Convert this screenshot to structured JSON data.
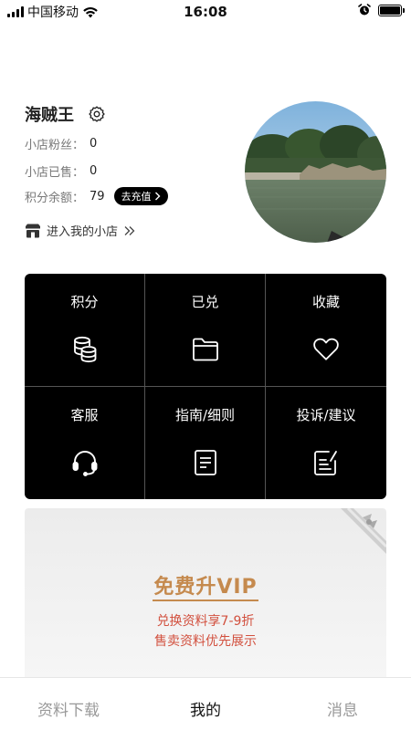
{
  "status_bar": {
    "carrier": "中国移动",
    "time": "16:08"
  },
  "profile": {
    "username": "海贼王",
    "fans_label": "小店粉丝：",
    "fans_value": "0",
    "sold_label": "小店已售：",
    "sold_value": "0",
    "points_label": "积分余额：",
    "points_value": "79",
    "recharge_label": "去充值",
    "enter_shop_label": "进入我的小店"
  },
  "menu": {
    "items": [
      {
        "label": "积分",
        "icon": "coins-icon"
      },
      {
        "label": "已兑",
        "icon": "folder-icon"
      },
      {
        "label": "收藏",
        "icon": "heart-icon"
      },
      {
        "label": "客服",
        "icon": "headset-icon"
      },
      {
        "label": "指南/细则",
        "icon": "document-icon"
      },
      {
        "label": "投诉/建议",
        "icon": "edit-note-icon"
      }
    ]
  },
  "vip_banner": {
    "title": "免费升VIP",
    "line1": "兑换资料享7-9折",
    "line2": "售卖资料优先展示"
  },
  "tab_bar": {
    "items": [
      {
        "label": "资料下载"
      },
      {
        "label": "我的"
      },
      {
        "label": "消息"
      }
    ],
    "active_index": 1
  },
  "colors": {
    "vip_gold": "#c58a4e",
    "vip_red": "#d2503e",
    "menu_bg": "#000000"
  }
}
